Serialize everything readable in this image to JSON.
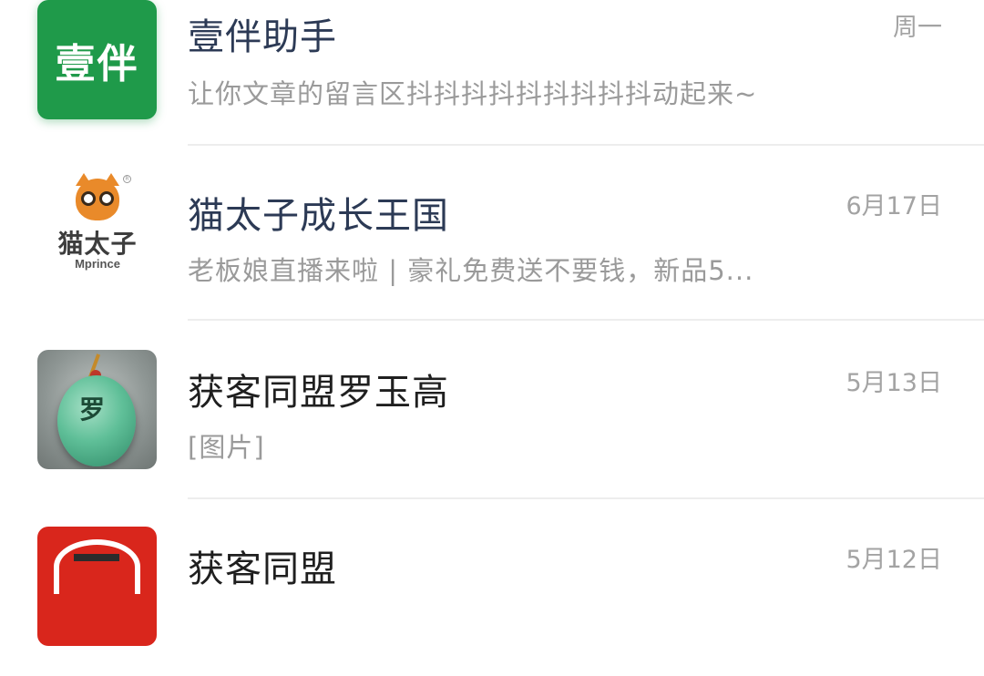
{
  "chats": [
    {
      "name": "壹伴助手",
      "preview": "让你文章的留言区抖抖抖抖抖抖抖抖抖动起来~",
      "time": "周一",
      "avatar": {
        "text": "壹伴",
        "bg": "#1f9a4a"
      }
    },
    {
      "name": "猫太子成长王国",
      "preview": "老板娘直播来啦 | 豪礼免费送不要钱，新品5...",
      "time": "6月17日",
      "avatar": {
        "text": "猫太子",
        "subtext": "Mprince",
        "bg": "#ffffff",
        "accent": "#e98a2a"
      }
    },
    {
      "name": "获客同盟罗玉高",
      "preview": "[图片]",
      "time": "5月13日",
      "avatar": {
        "text": "罗",
        "bg": "#8e9694",
        "accent": "#5fbf98"
      }
    },
    {
      "name": "获客同盟",
      "preview": "",
      "time": "5月12日",
      "avatar": {
        "bg": "#d9261c"
      }
    }
  ]
}
